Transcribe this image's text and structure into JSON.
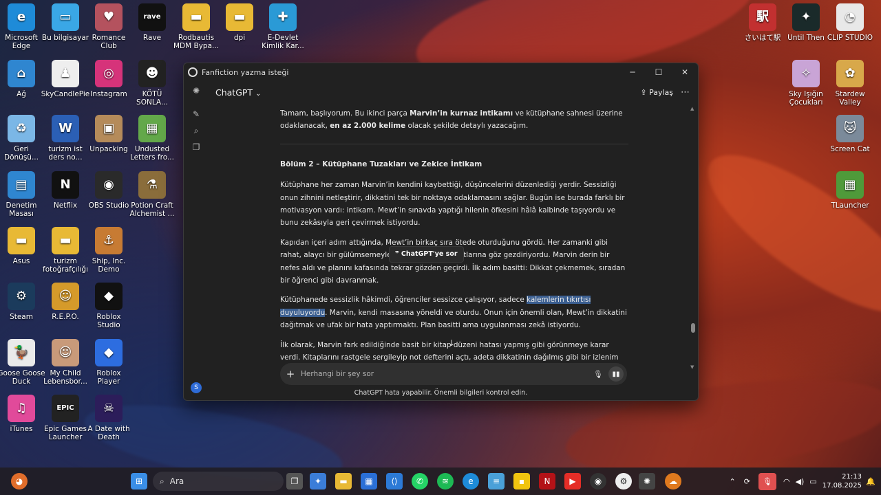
{
  "desktop": {
    "icons": [
      {
        "label": "Microsoft Edge",
        "glyph": "e",
        "color": "#1e8bd8"
      },
      {
        "label": "Bu bilgisayar",
        "glyph": "▭",
        "color": "#3aa7e6"
      },
      {
        "label": "Romance Club",
        "glyph": "♥",
        "color": "#b4525e"
      },
      {
        "label": "Rave",
        "glyph": "rave",
        "color": "#111111"
      },
      {
        "label": "Rodbautis MDM Bypa...",
        "glyph": "▬",
        "color": "#e8b935"
      },
      {
        "label": "dpi",
        "glyph": "▬",
        "color": "#e8b935"
      },
      {
        "label": "E-Devlet Kimlik Kar...",
        "glyph": "✚",
        "color": "#2a9ad6"
      },
      {
        "label": "Ağ",
        "glyph": "⌂",
        "color": "#2f86d0"
      },
      {
        "label": "SkyCandlePie",
        "glyph": "♟",
        "color": "#eeeeee"
      },
      {
        "label": "Instagram",
        "glyph": "◎",
        "color": "#d6337a"
      },
      {
        "label": "KÖTÜ SONLA...",
        "glyph": "☻",
        "color": "#222222"
      },
      {
        "label": "Geri Dönüşü...",
        "glyph": "♻",
        "color": "#7bb7e6"
      },
      {
        "label": "turizm ist ders no...",
        "glyph": "W",
        "color": "#2b5fb5"
      },
      {
        "label": "Unpacking",
        "glyph": "▣",
        "color": "#b58b5a"
      },
      {
        "label": "Undusted Letters fro...",
        "glyph": "▦",
        "color": "#63a84a"
      },
      {
        "label": "Denetim Masası",
        "glyph": "▤",
        "color": "#2f86d0"
      },
      {
        "label": "Netflix",
        "glyph": "N",
        "color": "#111111"
      },
      {
        "label": "OBS Studio",
        "glyph": "◉",
        "color": "#2a2a2a"
      },
      {
        "label": "Potion Craft Alchemist ...",
        "glyph": "⚗",
        "color": "#8a6d3b"
      },
      {
        "label": "Asus",
        "glyph": "▬",
        "color": "#e8b935"
      },
      {
        "label": "turizm fotoğrafçılığı",
        "glyph": "▬",
        "color": "#e8b935"
      },
      {
        "label": "Ship, Inc. Demo",
        "glyph": "⚓",
        "color": "#c77b33"
      },
      {
        "label": "Steam",
        "glyph": "⚙",
        "color": "#1b3b5c"
      },
      {
        "label": "R.E.P.O.",
        "glyph": "☺",
        "color": "#d59a2a"
      },
      {
        "label": "Roblox Studio",
        "glyph": "◆",
        "color": "#111111"
      },
      {
        "label": "Goose Goose Duck",
        "glyph": "🦆",
        "color": "#eaeaea"
      },
      {
        "label": "My Child Lebensbor...",
        "glyph": "☺",
        "color": "#c89a7a"
      },
      {
        "label": "Roblox Player",
        "glyph": "◆",
        "color": "#2d6de0"
      },
      {
        "label": "iTunes",
        "glyph": "♫",
        "color": "#e14a9a"
      },
      {
        "label": "Epic Games Launcher",
        "glyph": "EPIC",
        "color": "#222222"
      },
      {
        "label": "A Date with Death",
        "glyph": "☠",
        "color": "#2c1d5a"
      },
      {
        "label": "さいはて駅",
        "glyph": "駅",
        "color": "#c23030"
      },
      {
        "label": "Until Then",
        "glyph": "✦",
        "color": "#1a2a2a"
      },
      {
        "label": "CLIP STUDIO",
        "glyph": "◔",
        "color": "#e8e8e8"
      },
      {
        "label": "Sky Işığın Çocukları",
        "glyph": "✧",
        "color": "#c9a4d6"
      },
      {
        "label": "Stardew Valley",
        "glyph": "✿",
        "color": "#d8a84a"
      },
      {
        "label": "Screen Cat",
        "glyph": "🐱",
        "color": "#7b8a9a"
      },
      {
        "label": "TLauncher",
        "glyph": "▦",
        "color": "#4f9a3a"
      }
    ]
  },
  "window": {
    "title": "Fanfiction yazma isteği",
    "controls": {
      "minimize": "─",
      "maximize": "☐",
      "close": "✕"
    },
    "model_label": "ChatGPT",
    "model_chevron": "⌄",
    "share_label": "Paylaş",
    "more_label": "⋯",
    "intro": {
      "p1": "Tamam, başlıyorum. Bu ikinci parça ",
      "b1": "Marvin’in kurnaz intikamı",
      "p2": " ve kütüphane sahnesi üzerine odaklanacak, ",
      "b2": "en az 2.000 kelime",
      "p3": " olacak şekilde detaylı yazacağım."
    },
    "heading": "Bölüm 2 – Kütüphane Tuzakları ve Zekice İntikam",
    "para1": "Kütüphane her zaman Marvin’in kendini kaybettiği, düşüncelerini düzenlediği yerdir. Sessizliği onun zihnini netleştirir, dikkatini tek bir noktaya odaklamasını sağlar. Bugün ise burada farklı bir motivasyon vardı: intikam. Mewt’in sınavda yaptığı hilenin öfkesini hâlâ kalbinde taşıyordu ve bunu zekâsıyla geri çevirmek istiyordu.",
    "para2": "Kapıdan içeri adım attığında, Mewt’in birkaç sıra ötede oturduğunu gördü. Her zamanki gibi rahat, alaycı bir gülümsemeyle etrafa bakıyor, kağıtlarına göz gezdiriyordu. Marvin derin bir nefes aldı ve planını kafasında tekrar gözden geçirdi. İlk adım basitti: Dikkat çekmemek, sıradan bir öğrenci gibi davranmak.",
    "para3a": "Kütüphanede sessizlik hâkimdi, öğrenciler sessizce çalışıyor, sadece ",
    "para3hl": "kalemlerin tıkırtısı duyuluyordu",
    "para3b": ". Marvin, kendi masasına yöneldi ve oturdu. Onun için önemli olan, Mewt’in dikkatini dağıtmak ve ufak bir hata yaptırmaktı. Plan basitti ama uygulanması zekâ istiyordu.",
    "para4": "İlk olarak, Marvin fark edildiğinde basit bir kitap düzeni hatası yapmış gibi görünmeye karar verdi. Kitaplarını rastgele sergileyip not defterini açtı, adeta dikkatinin dağılmış gibi bir izlenim verdi. Mewt’in gözleri hemen bunu fark etti ve dudaklarının kenarında hafif bir gülümseme belirdi; Marvin’in böyle dağınık olması, Mewt için bir zaaf işaretiydi. Tam da beklediği tepkiyi veriyordu.",
    "tooltip": "❞  ChatGPT'ye sor",
    "composer_placeholder": "Herhangi bir şey sor",
    "disclaimer": "ChatGPT hata yapabilir. Önemli bilgileri kontrol edin."
  },
  "taskbar": {
    "search_label": "Ara",
    "clock_time": "21:13",
    "clock_date": "17.08.2025"
  }
}
